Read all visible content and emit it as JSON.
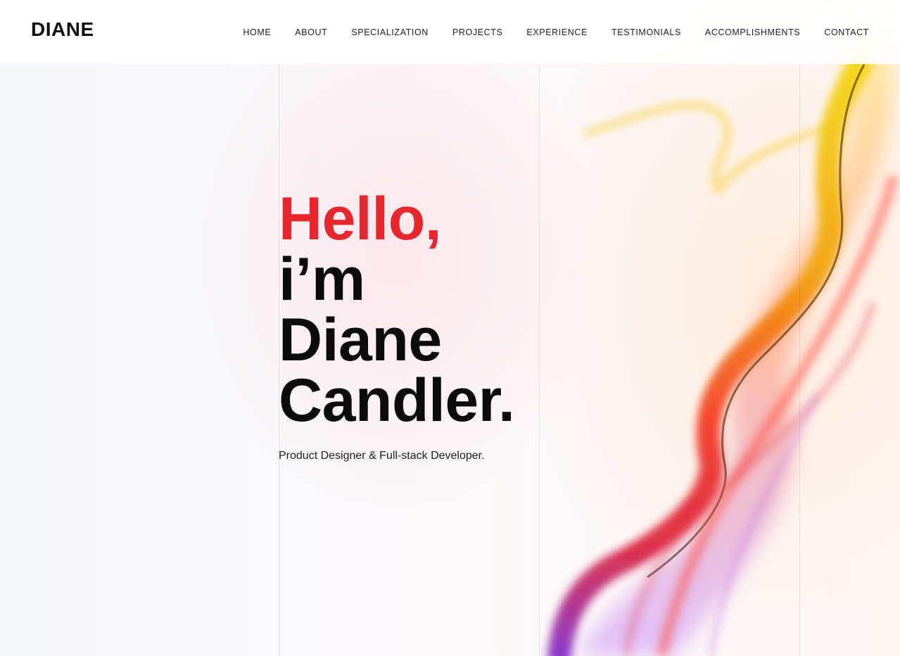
{
  "header": {
    "logo": "DIANE",
    "nav": [
      "HOME",
      "ABOUT",
      "SPECIALIZATION",
      "PROJECTS",
      "EXPERIENCE",
      "TESTIMONIALS",
      "ACCOMPLISHMENTS",
      "CONTACT"
    ]
  },
  "hero": {
    "greeting": "Hello,",
    "line2": "i’m",
    "line3": "Diane",
    "line4": "Candler.",
    "subtitle": "Product Designer & Full-stack Developer."
  },
  "colors": {
    "accent": "#e8262e",
    "text": "#0b0b0b",
    "header_bg": "#ffffff"
  }
}
